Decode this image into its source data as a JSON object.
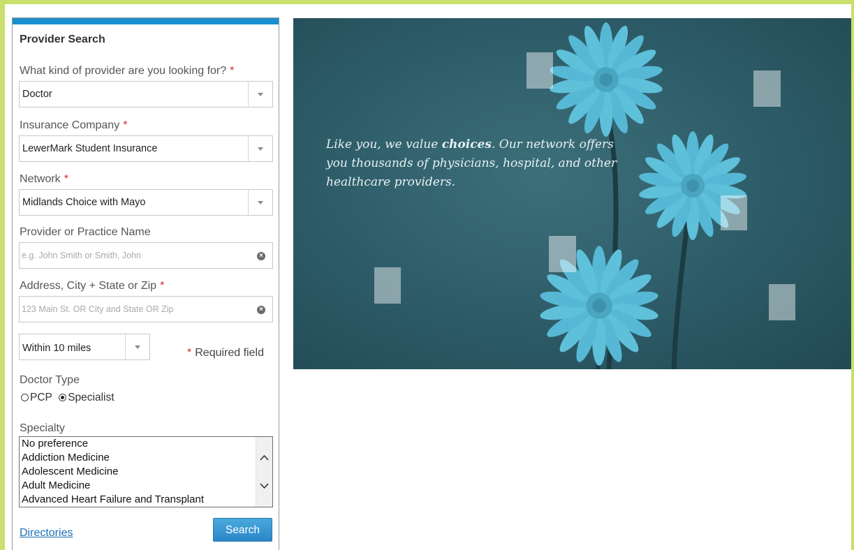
{
  "panel": {
    "title": "Provider Search",
    "required_marker": "*",
    "provider_kind": {
      "label": "What kind of provider are you looking for?",
      "value": "Doctor"
    },
    "insurance": {
      "label": "Insurance Company",
      "value": "LewerMark Student Insurance"
    },
    "network": {
      "label": "Network",
      "value": "Midlands Choice with Mayo"
    },
    "provider_name": {
      "label": "Provider or Practice Name",
      "value": "",
      "placeholder": "e.g. John Smith or Smith, John"
    },
    "address": {
      "label": "Address, City + State or Zip",
      "value": "",
      "placeholder": "123 Main St. OR City and State OR Zip"
    },
    "distance": {
      "value": "Within 10 miles"
    },
    "required_note": "Required field",
    "doctor_type": {
      "label": "Doctor Type",
      "options": [
        "PCP",
        "Specialist"
      ],
      "selected": "Specialist"
    },
    "specialty": {
      "label": "Specialty",
      "items": [
        "No preference",
        "Addiction Medicine",
        "Adolescent Medicine",
        "Adult Medicine",
        "Advanced Heart Failure and Transplant"
      ]
    },
    "directories_link": "Directories",
    "search_button": "Search"
  },
  "hero": {
    "text_pre": "Like you, we value ",
    "text_bold": "choices",
    "text_post": ". Our network offers you thousands of physicians, hospital, and other healthcare providers."
  },
  "colors": {
    "frame": "#c9e06c",
    "panel_accent": "#1b8fd0",
    "required": "#d0282f",
    "link": "#1a6fb5",
    "hero_bg": "#2f5f6b",
    "flower": "#56b8d4"
  },
  "icons": {
    "dropdown": "caret-down-icon",
    "clear": "clear-circle-x-icon",
    "scroll_up": "chevron-up-icon",
    "scroll_down": "chevron-down-icon"
  }
}
